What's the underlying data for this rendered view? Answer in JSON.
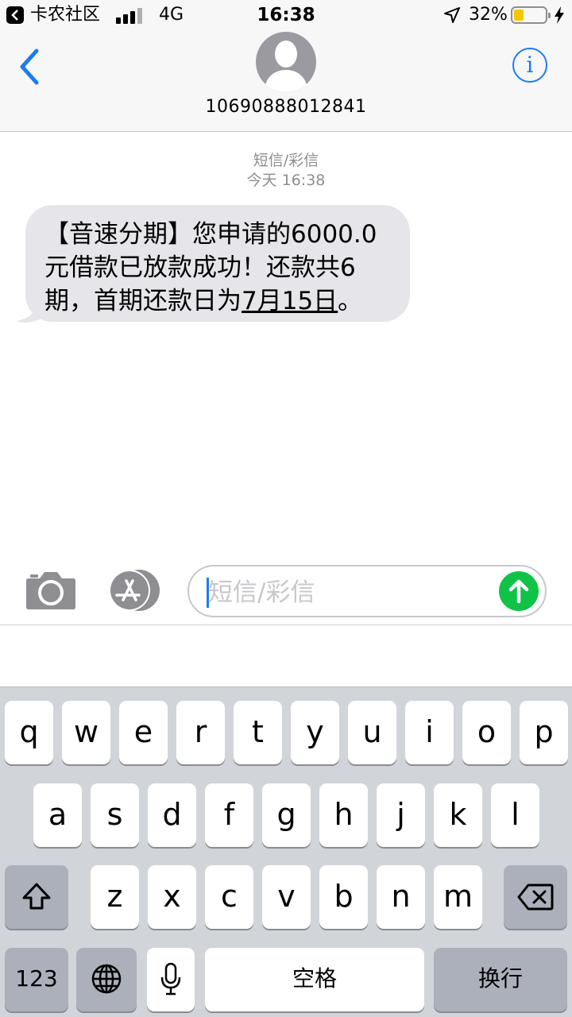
{
  "status_bar": {
    "back_app_name": "卡农社区",
    "network": "4G",
    "time": "16:38",
    "battery_percent": "32%",
    "battery_level": 0.32,
    "battery_color": "#f7c600"
  },
  "header": {
    "back_icon": "chevron-left-icon",
    "avatar_icon": "person-silhouette-icon",
    "contact": "10690888012841",
    "info_icon": "i"
  },
  "conversation": {
    "service_label": "短信/彩信",
    "timestamp": "今天 16:38",
    "messages": [
      {
        "direction": "incoming",
        "text_before_link": "【音速分期】您申请的6000.0元借款已放款成功！还款共6期，首期还款日为",
        "link": "7月15日",
        "text_after_link": "。"
      }
    ]
  },
  "composer": {
    "camera_icon": "camera-icon",
    "appstore_icon": "app-store-icon",
    "placeholder": "短信/彩信",
    "send_icon": "arrow-up-icon",
    "send_color": "#10c346"
  },
  "keyboard": {
    "row1": [
      "q",
      "w",
      "e",
      "r",
      "t",
      "y",
      "u",
      "i",
      "o",
      "p"
    ],
    "row2": [
      "a",
      "s",
      "d",
      "f",
      "g",
      "h",
      "j",
      "k",
      "l"
    ],
    "row3": [
      "z",
      "x",
      "c",
      "v",
      "b",
      "n",
      "m"
    ],
    "shift_icon": "shift-icon",
    "delete_icon": "delete-icon",
    "numbers_label": "123",
    "globe_icon": "globe-icon",
    "mic_icon": "microphone-icon",
    "space_label": "空格",
    "return_label": "换行"
  }
}
